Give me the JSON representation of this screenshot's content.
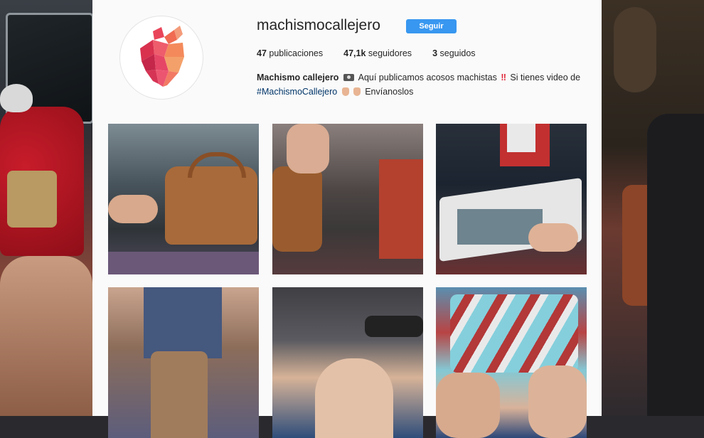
{
  "profile": {
    "username": "machismocallejero",
    "follow_label": "Seguir",
    "stats": [
      {
        "value": "47",
        "label": "publicaciones"
      },
      {
        "value": "47,1k",
        "label": "seguidores"
      },
      {
        "value": "3",
        "label": "seguidos"
      }
    ],
    "bio": {
      "name": "Machismo callejero",
      "text1": "Aquí publicamos acosos machistas",
      "text2": "Si tienes video de",
      "hashtag": "#MachismoCallejero",
      "text3": "Envíanoslos"
    },
    "avatar_icon": "heart-polygon-icon"
  },
  "colors": {
    "follow_button": "#3897f0",
    "panel_bg": "#fafafa",
    "text": "#262626"
  },
  "posts": [
    {
      "icon": "photo-handbag"
    },
    {
      "icon": "photo-phone-coat"
    },
    {
      "icon": "photo-magazine"
    },
    {
      "icon": "photo-boots"
    },
    {
      "icon": "photo-knees"
    },
    {
      "icon": "photo-shorts"
    }
  ]
}
